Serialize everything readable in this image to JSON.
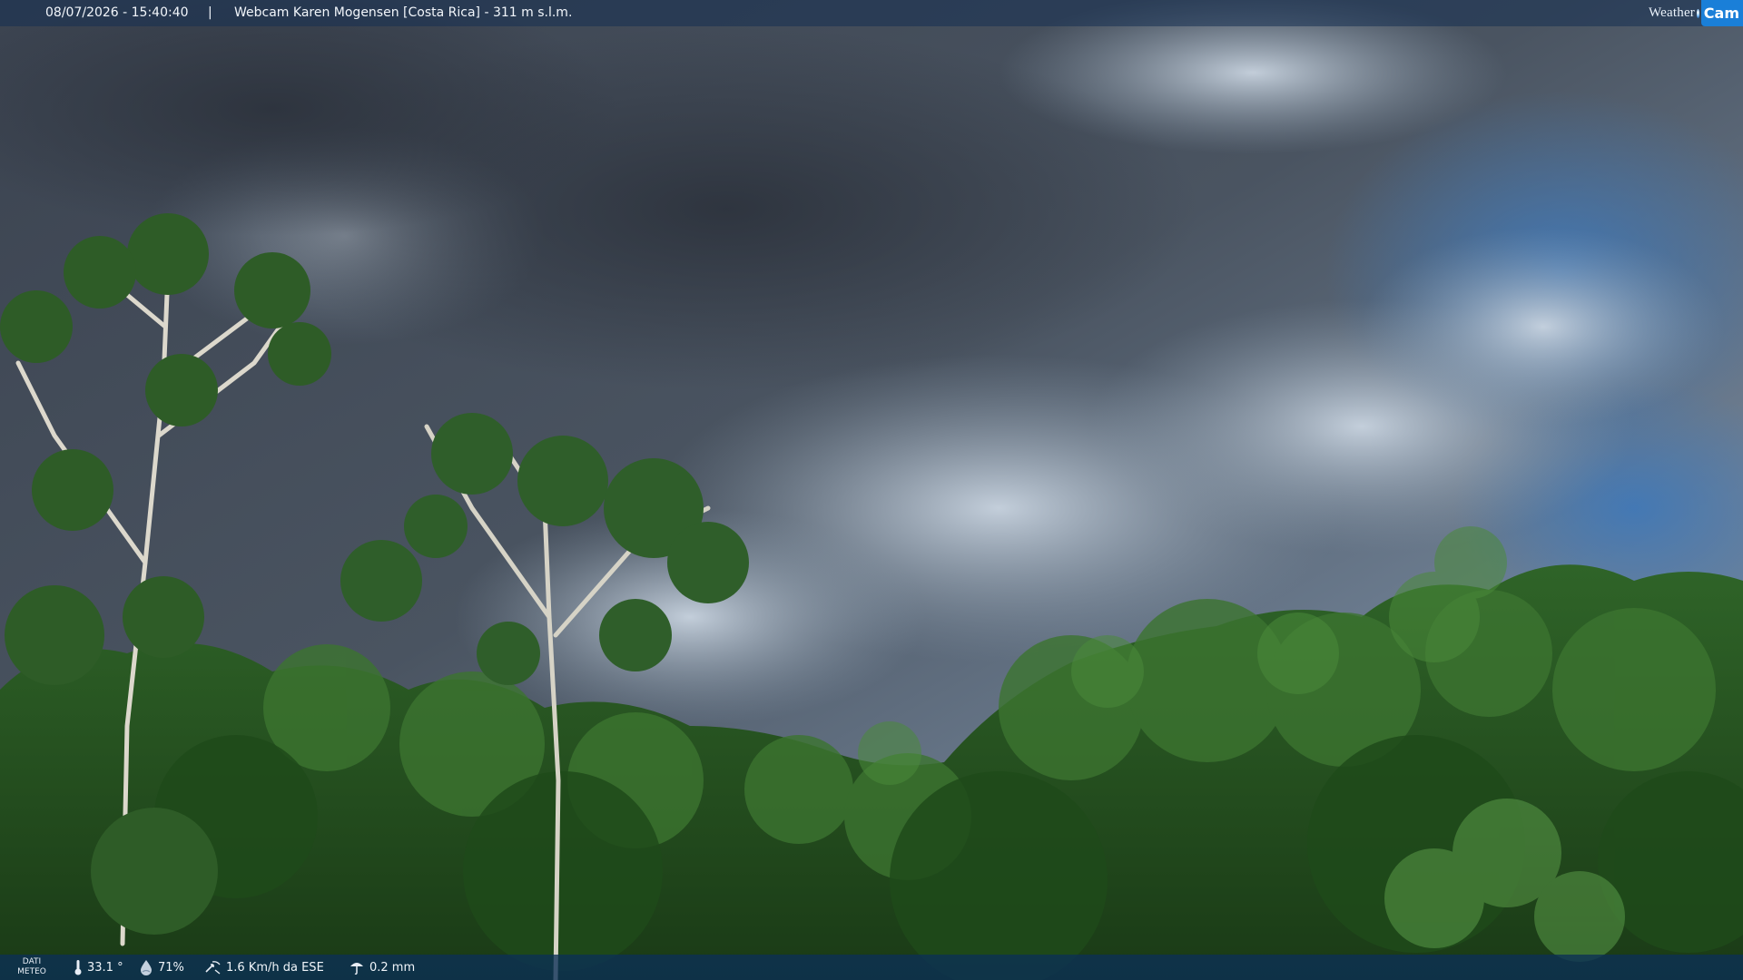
{
  "overlay": {
    "timestamp": "08/07/2026 - 15:40:40",
    "separator": "|",
    "camera_title": "Webcam Karen Mogensen [Costa Rica]  - 311 m s.l.m.",
    "brand": {
      "word": "Weather",
      "cam": "Cam",
      "accent": "#1a7fd8"
    }
  },
  "weather": {
    "section_label_line1": "DATI",
    "section_label_line2": "METEO",
    "temperature": "33.1 °",
    "humidity": "71%",
    "wind": "1.6 Km/h da ESE",
    "rain": "0.2 mm",
    "icons": [
      "thermometer-icon",
      "humidity-icon",
      "wind-icon",
      "rain-icon"
    ]
  },
  "colors": {
    "storm_cloud": "#3e4653",
    "sky_blue": "#4f80b5",
    "foliage": "#2a5a22",
    "bar_bg": "#163052"
  }
}
